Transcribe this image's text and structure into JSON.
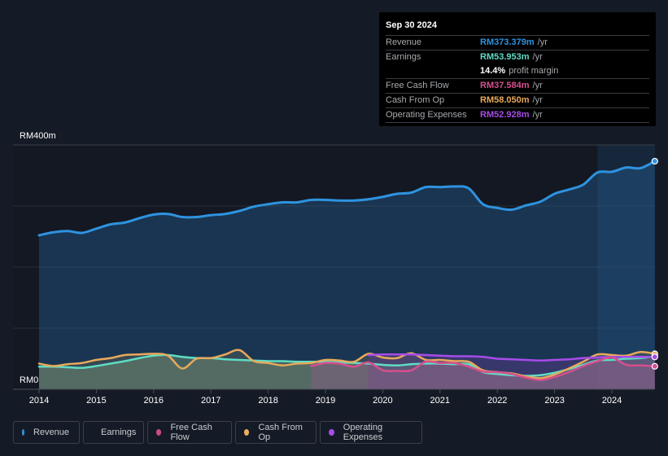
{
  "tooltip": {
    "date": "Sep 30 2024",
    "rows": [
      {
        "label": "Revenue",
        "value": "RM373.379m",
        "unit": "/yr",
        "color": "#2e93e0"
      },
      {
        "label": "Earnings",
        "value": "RM53.953m",
        "unit": "/yr",
        "color": "#5fdcc4"
      },
      {
        "label": "",
        "value": "14.4%",
        "unit": "profit margin",
        "color": "#ffffff"
      },
      {
        "label": "Free Cash Flow",
        "value": "RM37.584m",
        "unit": "/yr",
        "color": "#d64f8e"
      },
      {
        "label": "Cash From Op",
        "value": "RM58.050m",
        "unit": "/yr",
        "color": "#e8a95b"
      },
      {
        "label": "Operating Expenses",
        "value": "RM52.928m",
        "unit": "/yr",
        "color": "#a74ce8"
      }
    ]
  },
  "legend": [
    {
      "label": "Revenue",
      "color": "#2e93e0"
    },
    {
      "label": "Earnings",
      "color": "#5fdcc4"
    },
    {
      "label": "Free Cash Flow",
      "color": "#c84c86"
    },
    {
      "label": "Cash From Op",
      "color": "#e8b05e"
    },
    {
      "label": "Operating Expenses",
      "color": "#a74ce8"
    }
  ],
  "chart_data": {
    "type": "area",
    "title": "",
    "xlabel": "",
    "ylabel": "",
    "ylim": [
      0,
      400
    ],
    "xlim": [
      2014,
      2024.75
    ],
    "y_tick_labels": [
      "RM0",
      "RM400m"
    ],
    "x_tick_labels": [
      "2014",
      "2015",
      "2016",
      "2017",
      "2018",
      "2019",
      "2020",
      "2021",
      "2022",
      "2023",
      "2024"
    ],
    "grid": true,
    "highlight_start": 2023.75,
    "series": [
      {
        "name": "Revenue",
        "color": "#2e93e0",
        "start": 2014,
        "x": [
          2014,
          2014.25,
          2014.5,
          2014.75,
          2015,
          2015.25,
          2015.5,
          2015.75,
          2016,
          2016.25,
          2016.5,
          2016.75,
          2017,
          2017.25,
          2017.5,
          2017.75,
          2018,
          2018.25,
          2018.5,
          2018.75,
          2019,
          2019.25,
          2019.5,
          2019.75,
          2020,
          2020.25,
          2020.5,
          2020.75,
          2021,
          2021.25,
          2021.5,
          2021.75,
          2022,
          2022.25,
          2022.5,
          2022.75,
          2023,
          2023.25,
          2023.5,
          2023.75,
          2024,
          2024.25,
          2024.5,
          2024.75
        ],
        "values": [
          252,
          257,
          259,
          256,
          263,
          270,
          273,
          280,
          286,
          287,
          282,
          282,
          285,
          287,
          292,
          299,
          303,
          306,
          306,
          310,
          310,
          309,
          309,
          311,
          315,
          320,
          322,
          331,
          331,
          332,
          329,
          303,
          297,
          294,
          301,
          307,
          320,
          327,
          335,
          355,
          356,
          363,
          362,
          373.4
        ]
      },
      {
        "name": "Earnings",
        "color": "#5fdcc4",
        "start": 2014,
        "x": [
          2014,
          2014.25,
          2014.5,
          2014.75,
          2015,
          2015.25,
          2015.5,
          2015.75,
          2016,
          2016.25,
          2016.5,
          2016.75,
          2017,
          2017.25,
          2017.5,
          2017.75,
          2018,
          2018.25,
          2018.5,
          2018.75,
          2019,
          2019.25,
          2019.5,
          2019.75,
          2020,
          2020.25,
          2020.5,
          2020.75,
          2021,
          2021.25,
          2021.5,
          2021.75,
          2022,
          2022.25,
          2022.5,
          2022.75,
          2023,
          2023.25,
          2023.5,
          2023.75,
          2024,
          2024.25,
          2024.5,
          2024.75
        ],
        "values": [
          37,
          37,
          36,
          35,
          38,
          42,
          46,
          51,
          55,
          56,
          53,
          51,
          51,
          49,
          48,
          47,
          46,
          46,
          45,
          45,
          45,
          44,
          43,
          42,
          40,
          39,
          41,
          42,
          42,
          41,
          41,
          28,
          25,
          23,
          22,
          23,
          27,
          33,
          40,
          47,
          48,
          50,
          51,
          54
        ]
      },
      {
        "name": "Free Cash Flow",
        "color": "#d64f8e",
        "start": 2018.75,
        "x": [
          2018.75,
          2019,
          2019.25,
          2019.5,
          2019.75,
          2020,
          2020.25,
          2020.5,
          2020.75,
          2021,
          2021.25,
          2021.5,
          2021.75,
          2022,
          2022.25,
          2022.5,
          2022.75,
          2023,
          2023.25,
          2023.5,
          2023.75,
          2024,
          2024.25,
          2024.5,
          2024.75
        ],
        "values": [
          38,
          43,
          42,
          37,
          44,
          31,
          30,
          31,
          45,
          43,
          43,
          37,
          29,
          28,
          25,
          19,
          15,
          20,
          28,
          38,
          46,
          52,
          40,
          39,
          37.6
        ]
      },
      {
        "name": "Cash From Op",
        "color": "#e8a95b",
        "start": 2014,
        "x": [
          2014,
          2014.25,
          2014.5,
          2014.75,
          2015,
          2015.25,
          2015.5,
          2015.75,
          2016,
          2016.25,
          2016.5,
          2016.75,
          2017,
          2017.25,
          2017.5,
          2017.75,
          2018,
          2018.25,
          2018.5,
          2018.75,
          2019,
          2019.25,
          2019.5,
          2019.75,
          2020,
          2020.25,
          2020.5,
          2020.75,
          2021,
          2021.25,
          2021.5,
          2021.75,
          2022,
          2022.25,
          2022.5,
          2022.75,
          2023,
          2023.25,
          2023.5,
          2023.75,
          2024,
          2024.25,
          2024.5,
          2024.75
        ],
        "values": [
          42,
          38,
          41,
          43,
          48,
          51,
          56,
          57,
          58,
          55,
          34,
          50,
          51,
          57,
          64,
          46,
          43,
          39,
          42,
          43,
          48,
          47,
          45,
          58,
          52,
          51,
          59,
          48,
          48,
          46,
          45,
          31,
          28,
          26,
          21,
          18,
          24,
          34,
          45,
          57,
          56,
          55,
          61,
          58
        ]
      },
      {
        "name": "Operating Expenses",
        "color": "#a74ce8",
        "start": 2019.75,
        "x": [
          2019.75,
          2020,
          2020.25,
          2020.5,
          2020.75,
          2021,
          2021.25,
          2021.5,
          2021.75,
          2022,
          2022.25,
          2022.5,
          2022.75,
          2023,
          2023.25,
          2023.5,
          2023.75,
          2024,
          2024.25,
          2024.5,
          2024.75
        ],
        "values": [
          56,
          57,
          57,
          57,
          56,
          55,
          54,
          54,
          53,
          50,
          49,
          48,
          47,
          48,
          49,
          51,
          52,
          53,
          53,
          53,
          52.9
        ]
      }
    ]
  }
}
